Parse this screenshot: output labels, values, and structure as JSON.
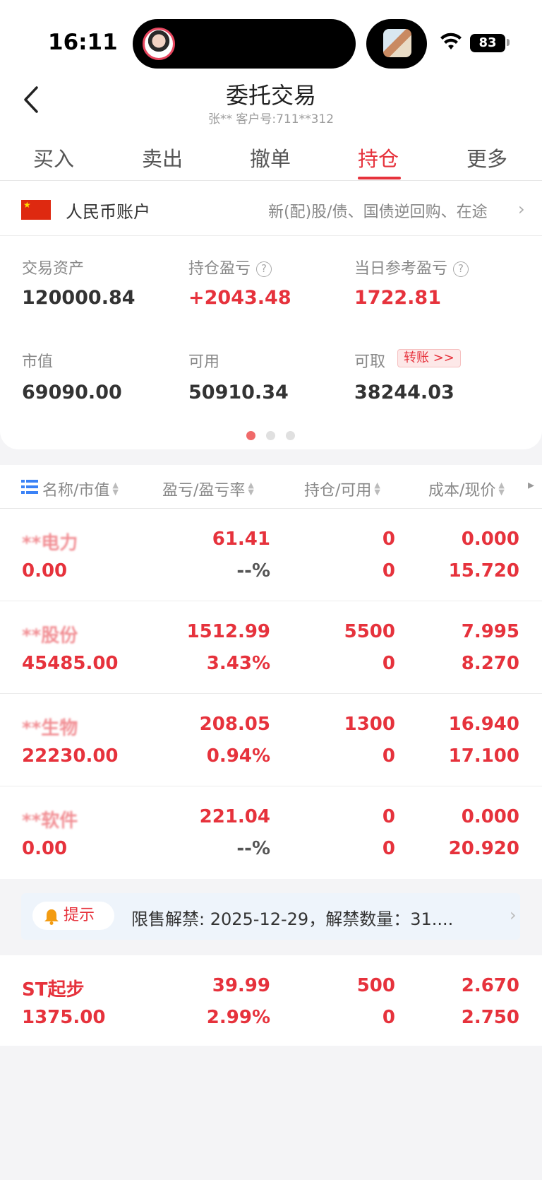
{
  "status_bar": {
    "time": "16:11",
    "battery": "83"
  },
  "header": {
    "title": "委托交易",
    "subtitle": "张** 客户号:711**312"
  },
  "tabs": [
    {
      "label": "买入",
      "active": false
    },
    {
      "label": "卖出",
      "active": false
    },
    {
      "label": "撤单",
      "active": false
    },
    {
      "label": "持仓",
      "active": true
    },
    {
      "label": "更多",
      "active": false
    }
  ],
  "account": {
    "name": "人民币账户",
    "note": "新(配)股/债、国债逆回购、在途",
    "metrics": {
      "trade_assets": {
        "label": "交易资产",
        "value": "120000.84"
      },
      "position_pnl": {
        "label": "持仓盈亏",
        "value": "+2043.48"
      },
      "daily_pnl": {
        "label": "当日参考盈亏",
        "value": "1722.81"
      },
      "market_value": {
        "label": "市值",
        "value": "69090.00"
      },
      "available": {
        "label": "可用",
        "value": "50910.34"
      },
      "withdrawable": {
        "label": "可取",
        "value": "38244.03"
      }
    },
    "transfer_label": "转账 >>",
    "page_count": 3,
    "page_active": 1
  },
  "table": {
    "headers": [
      "名称/市值",
      "盈亏/盈亏率",
      "持仓/可用",
      "成本/现价"
    ],
    "rows": [
      {
        "name": "**电力",
        "market_value": "0.00",
        "pnl": "61.41",
        "pnl_rate": "--%",
        "holding": "0",
        "available": "0",
        "cost": "0.000",
        "price": "15.720"
      },
      {
        "name": "**股份",
        "market_value": "45485.00",
        "pnl": "1512.99",
        "pnl_rate": "3.43%",
        "holding": "5500",
        "available": "0",
        "cost": "7.995",
        "price": "8.270"
      },
      {
        "name": "**生物",
        "market_value": "22230.00",
        "pnl": "208.05",
        "pnl_rate": "0.94%",
        "holding": "1300",
        "available": "0",
        "cost": "16.940",
        "price": "17.100"
      },
      {
        "name": "**软件",
        "market_value": "0.00",
        "pnl": "221.04",
        "pnl_rate": "--%",
        "holding": "0",
        "available": "0",
        "cost": "0.000",
        "price": "20.920"
      }
    ],
    "last_row": {
      "name": "ST起步",
      "market_value": "1375.00",
      "pnl": "39.99",
      "pnl_rate": "2.99%",
      "holding": "500",
      "available": "0",
      "cost": "2.670",
      "price": "2.750"
    }
  },
  "tip": {
    "badge": "提示",
    "text": "限售解禁: 2025-12-29，解禁数量：31...."
  },
  "colors": {
    "accent": "#e6323c",
    "text": "#333333",
    "muted": "#888888",
    "tip_bg": "#eef4fb"
  }
}
